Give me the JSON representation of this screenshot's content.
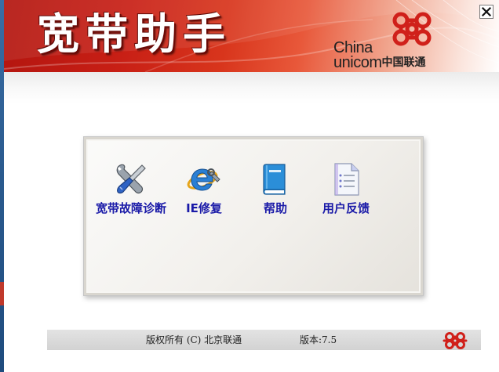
{
  "window": {
    "title": "宽带助手",
    "close_icon": "close-icon"
  },
  "brand": {
    "line1": "China",
    "line2": "unicom",
    "chinese": "中国联通",
    "logo_icon": "china-unicom-knot-icon",
    "accent_color": "#c81f15"
  },
  "tools": [
    {
      "label": "宽带故障诊断",
      "icon": "wrench-screwdriver-icon"
    },
    {
      "label": "IE修复",
      "icon": "ie-repair-icon"
    },
    {
      "label": "帮助",
      "icon": "help-book-icon"
    },
    {
      "label": "用户反馈",
      "icon": "feedback-document-icon"
    }
  ],
  "footer": {
    "copyright": "版权所有 (C) 北京联通",
    "version": "版本:7.5",
    "logo_icon": "china-unicom-knot-icon"
  }
}
